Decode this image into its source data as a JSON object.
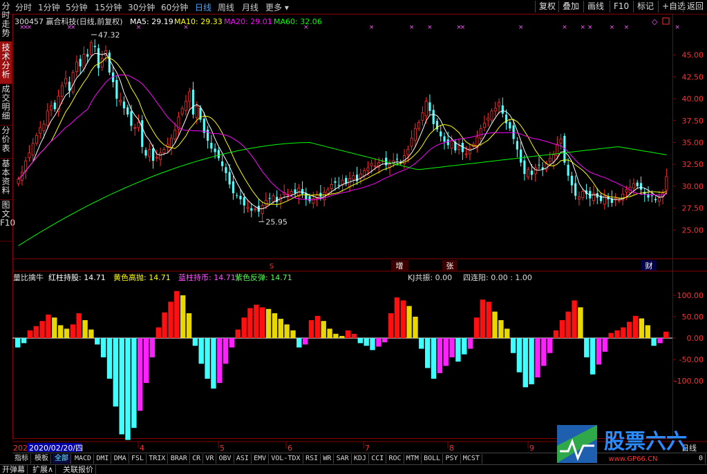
{
  "timeframes": [
    "分时",
    "1分钟",
    "5分钟",
    "15分钟",
    "30分钟",
    "60分钟",
    "日线",
    "周线",
    "月线",
    "更多 ▾"
  ],
  "active_timeframe": "日线",
  "toolbar_right": [
    "复权",
    "叠加",
    "画线",
    "F10",
    "标记",
    "+自选",
    "返回"
  ],
  "sidebar": [
    "分时走势",
    "技术分析",
    "成交明细",
    "分价表",
    "基本资料",
    "图文F10"
  ],
  "sidebar_active": "技术分析",
  "header": {
    "code": "300457",
    "name": "赢合科技(日线,前复权)",
    "ma5": "MA5: 29.19",
    "ma10": "MA10: 29.33",
    "ma20": "MA20: 29.01",
    "ma60": "MA60: 32.06"
  },
  "annotations": {
    "high": "47.32",
    "low": "25.95",
    "event1": "S",
    "event2": "增",
    "event3": "张",
    "event4": "财"
  },
  "indicator": {
    "name": "量比擒牛",
    "v1": "红柱持股: 14.71",
    "v2": "黄色高抛: 14.71",
    "v3": "蓝柱持币: 14.71",
    "v4": "紫色反弹: 14.71",
    "kj": "KJ共振: 0.00",
    "lian": "四连阳: 0.00 : 1.00"
  },
  "xaxis": {
    "first": "2020/02/20/四",
    "prefix": "202",
    "m4": "4",
    "m5": "5",
    "m6": "6",
    "m7": "7",
    "m8": "8",
    "m9": "9",
    "right": "日线"
  },
  "bottom_tabs": [
    "指标",
    "模板",
    "全部",
    "MACD",
    "DMI",
    "DMA",
    "FSL",
    "TRIX",
    "BRAR",
    "CR",
    "VR",
    "OBV",
    "ASI",
    "EMV",
    "VOL-TDX",
    "RSI",
    "WR",
    "SAR",
    "KDJ",
    "CCI",
    "ROC",
    "MTM",
    "BOLL",
    "PSY",
    "MCST"
  ],
  "bottom_active": "全部",
  "bottom2": [
    "开弹幕",
    "扩展∧",
    "关联报价"
  ],
  "bottom_right_zero": "0",
  "logo": {
    "text": "股票六六",
    "url": "www.GP66.CN"
  },
  "colors": {
    "up": "#ff3030",
    "down": "#54ffff",
    "ma5": "#ffffff",
    "ma10": "#ffff00",
    "ma20": "#ff00ff",
    "ma60": "#00ff00",
    "red_bar": "#ff1010",
    "yellow_bar": "#e8d800",
    "cyan_bar": "#40ffff",
    "magenta_bar": "#ff20ff"
  },
  "chart_data": [
    {
      "type": "candlestick",
      "title": "300457 赢合科技(日线,前复权)",
      "ylim": [
        22.5,
        47.5
      ],
      "yticks": [
        25.0,
        27.5,
        30.0,
        32.5,
        35.0,
        37.5,
        40.0,
        42.5,
        45.0
      ],
      "close": [
        30.8,
        31.6,
        32.9,
        33.8,
        34.9,
        35.8,
        36.7,
        37.1,
        38.6,
        39.2,
        38.8,
        40.3,
        41.5,
        42.3,
        40.9,
        43.0,
        44.2,
        43.7,
        45.1,
        44.8,
        46.4,
        45.9,
        43.5,
        44.6,
        45.5,
        43.0,
        41.9,
        40.0,
        39.8,
        38.9,
        38.2,
        36.9,
        36.7,
        37.3,
        34.5,
        33.5,
        34.2,
        32.9,
        33.3,
        33.8,
        34.2,
        34.8,
        35.5,
        36.4,
        37.9,
        38.9,
        39.7,
        40.8,
        38.2,
        39.1,
        37.6,
        36.1,
        35.2,
        34.3,
        33.9,
        33.2,
        32.3,
        31.5,
        30.2,
        29.2,
        28.9,
        28.5,
        27.8,
        27.6,
        27.2,
        27.4,
        27.1,
        27.8,
        28.4,
        28.6,
        28.9,
        28.2,
        28.7,
        29.3,
        29.1,
        29.4,
        29.2,
        29.8,
        29.1,
        28.5,
        28.3,
        28.6,
        29.0,
        28.8,
        29.3,
        29.6,
        30.2,
        30.4,
        30.1,
        30.7,
        30.3,
        30.9,
        31.2,
        30.6,
        31.4,
        31.8,
        32.1,
        32.6,
        32.3,
        32.7,
        32.9,
        32.4,
        32.6,
        32.9,
        33.1,
        32.7,
        33.5,
        34.2,
        35.5,
        36.6,
        37.3,
        38.4,
        39.7,
        38.6,
        37.1,
        36.5,
        35.7,
        35.1,
        34.7,
        35.2,
        34.1,
        34.6,
        33.9,
        33.7,
        34.3,
        34.8,
        35.6,
        36.6,
        37.2,
        37.8,
        38.6,
        38.9,
        39.6,
        38.3,
        37.2,
        36.6,
        35.4,
        34.2,
        32.7,
        31.4,
        31.9,
        31.3,
        32.1,
        32.4,
        31.9,
        32.6,
        33.2,
        33.6,
        34.8,
        35.4,
        32.7,
        31.2,
        30.1,
        28.9,
        28.8,
        29.4,
        29.1,
        28.6,
        29.2,
        28.7,
        28.3,
        28.9,
        28.5,
        28.1,
        28.6,
        28.4,
        29.1,
        29.6,
        29.9,
        30.3,
        30.0,
        29.6,
        29.1,
        28.7,
        28.9,
        28.4,
        28.7,
        29.2,
        31.1
      ],
      "ma60_endpoints": [
        [
          0,
          23.2
        ],
        [
          80,
          35.0
        ],
        [
          140,
          32.1
        ],
        [
          199,
          32.1
        ]
      ],
      "annotations": {
        "high": 47.32,
        "low": 25.95
      }
    },
    {
      "type": "bar",
      "title": "量比擒牛",
      "ylim": [
        -120,
        120
      ],
      "yticks": [
        -100.0,
        -50.0,
        0.0,
        50.0,
        100.0
      ],
      "bars": [
        {
          "c": "cyan",
          "v": -22
        },
        {
          "c": "cyan",
          "v": -12
        },
        {
          "c": "red",
          "v": 18
        },
        {
          "c": "red",
          "v": 28
        },
        {
          "c": "red",
          "v": 40
        },
        {
          "c": "red",
          "v": 55
        },
        {
          "c": "yellow",
          "v": 48
        },
        {
          "c": "yellow",
          "v": 30
        },
        {
          "c": "yellow",
          "v": 22
        },
        {
          "c": "red",
          "v": 32
        },
        {
          "c": "red",
          "v": 58
        },
        {
          "c": "yellow",
          "v": 42
        },
        {
          "c": "yellow",
          "v": 20
        },
        {
          "c": "cyan",
          "v": -15
        },
        {
          "c": "cyan",
          "v": -45
        },
        {
          "c": "cyan",
          "v": -95
        },
        {
          "c": "cyan",
          "v": -160
        },
        {
          "c": "cyan",
          "v": -225
        },
        {
          "c": "cyan",
          "v": -238
        },
        {
          "c": "cyan",
          "v": -210
        },
        {
          "c": "magenta",
          "v": -170
        },
        {
          "c": "magenta",
          "v": -105
        },
        {
          "c": "magenta",
          "v": -45
        },
        {
          "c": "red",
          "v": 25
        },
        {
          "c": "red",
          "v": 60
        },
        {
          "c": "red",
          "v": 85
        },
        {
          "c": "red",
          "v": 110
        },
        {
          "c": "yellow",
          "v": 100
        },
        {
          "c": "yellow",
          "v": 58
        },
        {
          "c": "cyan",
          "v": -18
        },
        {
          "c": "cyan",
          "v": -60
        },
        {
          "c": "cyan",
          "v": -95
        },
        {
          "c": "cyan",
          "v": -118
        },
        {
          "c": "magenta",
          "v": -105
        },
        {
          "c": "magenta",
          "v": -60
        },
        {
          "c": "magenta",
          "v": -22
        },
        {
          "c": "red",
          "v": 20
        },
        {
          "c": "red",
          "v": 48
        },
        {
          "c": "red",
          "v": 70
        },
        {
          "c": "red",
          "v": 78
        },
        {
          "c": "red",
          "v": 72
        },
        {
          "c": "yellow",
          "v": 68
        },
        {
          "c": "yellow",
          "v": 58
        },
        {
          "c": "yellow",
          "v": 45
        },
        {
          "c": "yellow",
          "v": 32
        },
        {
          "c": "yellow",
          "v": 18
        },
        {
          "c": "cyan",
          "v": -22
        },
        {
          "c": "magenta",
          "v": -15
        },
        {
          "c": "red",
          "v": 42
        },
        {
          "c": "red",
          "v": 52
        },
        {
          "c": "yellow",
          "v": 40
        },
        {
          "c": "yellow",
          "v": 22
        },
        {
          "c": "yellow",
          "v": 10
        },
        {
          "c": "yellow",
          "v": 5
        },
        {
          "c": "red",
          "v": 18
        },
        {
          "c": "red",
          "v": 10
        },
        {
          "c": "cyan",
          "v": -12
        },
        {
          "c": "cyan",
          "v": -18
        },
        {
          "c": "cyan",
          "v": -28
        },
        {
          "c": "magenta",
          "v": -20
        },
        {
          "c": "magenta",
          "v": -10
        },
        {
          "c": "red",
          "v": 58
        },
        {
          "c": "red",
          "v": 95
        },
        {
          "c": "red",
          "v": 88
        },
        {
          "c": "yellow",
          "v": 75
        },
        {
          "c": "yellow",
          "v": 50
        },
        {
          "c": "cyan",
          "v": -25
        },
        {
          "c": "cyan",
          "v": -70
        },
        {
          "c": "cyan",
          "v": -95
        },
        {
          "c": "magenta",
          "v": -82
        },
        {
          "c": "magenta",
          "v": -65
        },
        {
          "c": "magenta",
          "v": -45
        },
        {
          "c": "cyan",
          "v": -55
        },
        {
          "c": "cyan",
          "v": -38
        },
        {
          "c": "magenta",
          "v": -25
        },
        {
          "c": "red",
          "v": 48
        },
        {
          "c": "red",
          "v": 90
        },
        {
          "c": "red",
          "v": 85
        },
        {
          "c": "yellow",
          "v": 62
        },
        {
          "c": "yellow",
          "v": 42
        },
        {
          "c": "yellow",
          "v": 22
        },
        {
          "c": "cyan",
          "v": -35
        },
        {
          "c": "cyan",
          "v": -80
        },
        {
          "c": "cyan",
          "v": -115
        },
        {
          "c": "cyan",
          "v": -108
        },
        {
          "c": "magenta",
          "v": -92
        },
        {
          "c": "magenta",
          "v": -65
        },
        {
          "c": "magenta",
          "v": -35
        },
        {
          "c": "red",
          "v": 18
        },
        {
          "c": "red",
          "v": 42
        },
        {
          "c": "red",
          "v": 62
        },
        {
          "c": "red",
          "v": 88
        },
        {
          "c": "yellow",
          "v": 72
        },
        {
          "c": "cyan",
          "v": -45
        },
        {
          "c": "cyan",
          "v": -85
        },
        {
          "c": "magenta",
          "v": -62
        },
        {
          "c": "magenta",
          "v": -32
        },
        {
          "c": "red",
          "v": 12
        },
        {
          "c": "red",
          "v": 18
        },
        {
          "c": "red",
          "v": 25
        },
        {
          "c": "red",
          "v": 38
        },
        {
          "c": "red",
          "v": 52
        },
        {
          "c": "yellow",
          "v": 46
        },
        {
          "c": "yellow",
          "v": 30
        },
        {
          "c": "cyan",
          "v": -18
        },
        {
          "c": "magenta",
          "v": -12
        },
        {
          "c": "red",
          "v": 15
        }
      ]
    }
  ]
}
